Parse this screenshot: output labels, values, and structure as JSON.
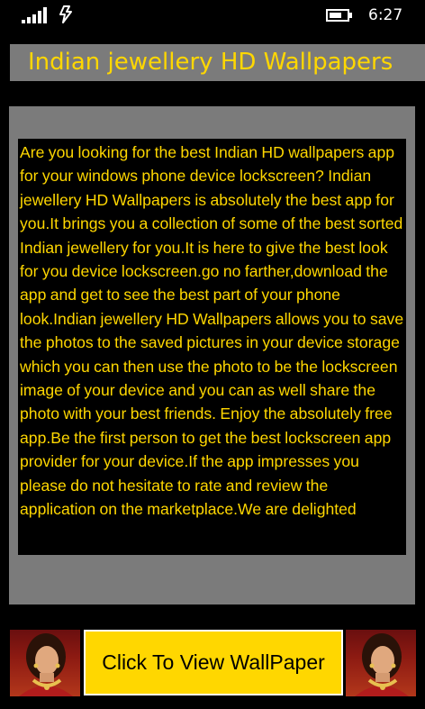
{
  "status_bar": {
    "time": "6:27",
    "icons": [
      "signal-strength-icon",
      "data-connection-icon",
      "battery-icon"
    ]
  },
  "app": {
    "title": "Indian jewellery HD Wallpapers"
  },
  "description": {
    "text": "Are you looking for the best Indian HD wallpapers app for your windows phone device lockscreen? Indian jewellery HD Wallpapers is absolutely the best app for  you.It brings you a collection of  some of the best sorted Indian jewellery for you.It is here to give the best look for you device lockscreen.go no farther,download the app and get to see the best part of your phone look.Indian jewellery HD Wallpapers allows you to save the photos to the saved pictures in your device storage which you can then use the photo to be the lockscreen image of your device and you can as well share the photo with your best friends. Enjoy the absolutely free app.Be the first person to get the best lockscreen app provider for your device.If the app impresses you please do not hesitate to rate and review the application on the marketplace.We are delighted"
  },
  "banner": {
    "button_label": "Click To View WallPaper",
    "thumbnails": [
      "jewellery-model-thumbnail-left",
      "jewellery-model-thumbnail-right"
    ]
  },
  "colors": {
    "accent": "#ffd700",
    "panel": "#7b7b7b",
    "background": "#000000"
  }
}
